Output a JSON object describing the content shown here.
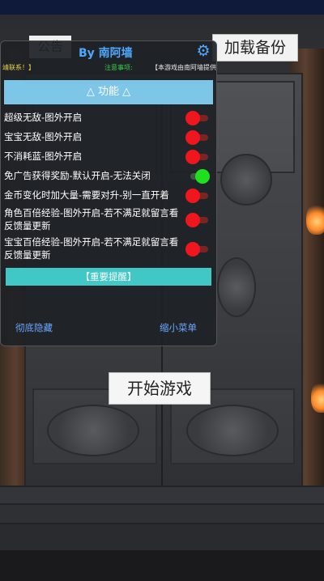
{
  "overlay": {
    "notice_tab": "公告",
    "load_backup": "加载备份",
    "start_game": "开始游戏"
  },
  "menu": {
    "title": "By 南阿墙",
    "marquee": {
      "left": "靖联系！】",
      "middle": "注意事项:",
      "right": "【本游戏由南阿墙提供"
    },
    "section_title": "△ 功能 △",
    "features": [
      {
        "label": "超级无敌-图外开启",
        "on": false
      },
      {
        "label": "宝宝无敌-图外开启",
        "on": false
      },
      {
        "label": "不消耗蓝-图外开启",
        "on": false
      },
      {
        "label": "免广告获得奖励-默认开启-无法关闭",
        "on": true
      },
      {
        "label": "金币变化时加大量-需要对升-别一直开着",
        "on": false
      },
      {
        "label": "角色百倍经验-图外开启-若不满足就留言看反馈量更新",
        "on": false
      },
      {
        "label": "宝宝百倍经验-图外开启-若不满足就留言看反馈量更新",
        "on": false
      }
    ],
    "reminder": "【重要提醒】",
    "hide_completely": "彻底隐藏",
    "shrink_menu": "缩小菜单"
  },
  "colors": {
    "accent_blue": "#4fa8ff",
    "section_bar": "#7ec6e8",
    "reminder_bar": "#41c8c6",
    "toggle_off": "#f0161e",
    "toggle_on": "#1fe01f"
  }
}
